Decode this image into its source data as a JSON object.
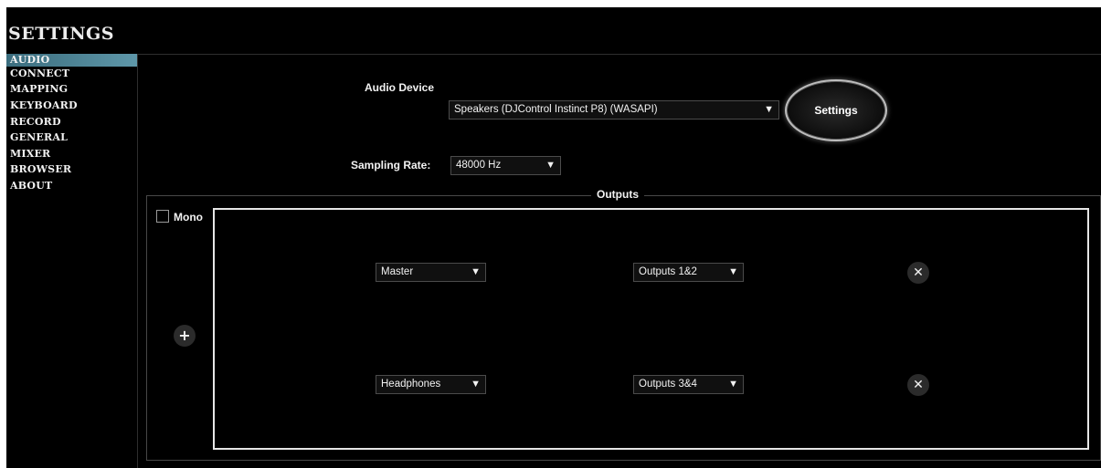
{
  "title": "SETTINGS",
  "sidebar": {
    "items": [
      {
        "label": "AUDIO",
        "active": true
      },
      {
        "label": "CONNECT",
        "active": false
      },
      {
        "label": "MAPPING",
        "active": false
      },
      {
        "label": "KEYBOARD",
        "active": false
      },
      {
        "label": "RECORD",
        "active": false
      },
      {
        "label": "GENERAL",
        "active": false
      },
      {
        "label": "MIXER",
        "active": false
      },
      {
        "label": "BROWSER",
        "active": false
      },
      {
        "label": "ABOUT",
        "active": false
      }
    ]
  },
  "audio": {
    "device_label": "Audio Device",
    "device_value": "Speakers (DJControl Instinct P8) (WASAPI)",
    "settings_button": "Settings",
    "sampling_label": "Sampling Rate:",
    "sampling_value": "48000 Hz"
  },
  "outputs": {
    "title": "Outputs",
    "mono_label": "Mono",
    "mono_checked": false,
    "add_icon": "plus-icon",
    "remove_icon": "close-icon",
    "rows": [
      {
        "source": "Master",
        "destination": "Outputs 1&2"
      },
      {
        "source": "Headphones",
        "destination": "Outputs 3&4"
      }
    ]
  },
  "icons": {
    "dropdown_arrow": "▼",
    "add": "+",
    "remove": "✕"
  },
  "colors": {
    "background": "#000000",
    "accent": "#5e97a9",
    "text": "#f2f2f2"
  }
}
